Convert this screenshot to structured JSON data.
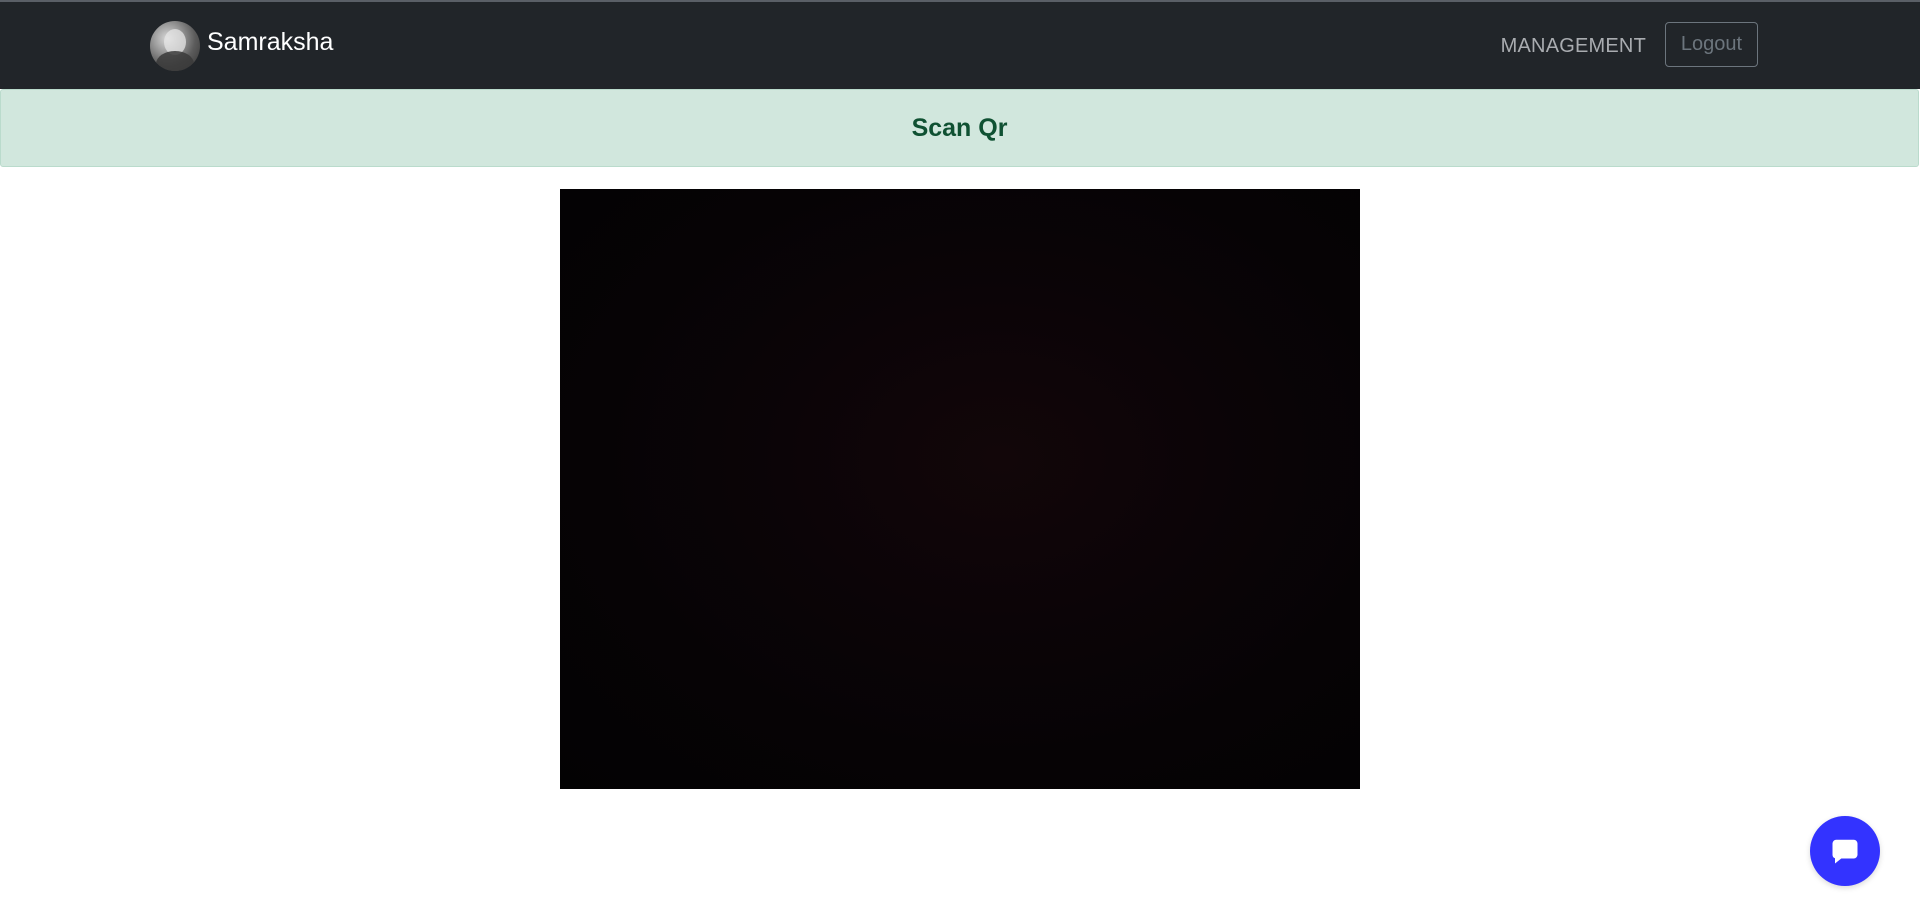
{
  "navbar": {
    "brand": "Samraksha",
    "links": [
      "MANAGEMENT"
    ],
    "logout_label": "Logout",
    "background": "#212529"
  },
  "banner": {
    "title": "Scan Qr",
    "background": "#d1e7dd",
    "text_color": "#0f5132"
  },
  "scanner": {
    "icon": "camera-feed"
  },
  "chat_button": {
    "icon": "chat-bubble-icon",
    "color": "#3333ff"
  }
}
